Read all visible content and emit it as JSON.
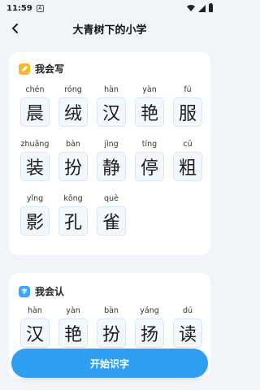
{
  "status": {
    "time": "11:59",
    "notification_badge": "A"
  },
  "nav": {
    "title": "大青树下的小学"
  },
  "write_section": {
    "title": "我会写",
    "rows": [
      [
        {
          "pinyin": "chén",
          "char": "晨"
        },
        {
          "pinyin": "róng",
          "char": "绒"
        },
        {
          "pinyin": "hàn",
          "char": "汉"
        },
        {
          "pinyin": "yàn",
          "char": "艳"
        },
        {
          "pinyin": "fú",
          "char": "服"
        }
      ],
      [
        {
          "pinyin": "zhuāng",
          "char": "装"
        },
        {
          "pinyin": "bàn",
          "char": "扮"
        },
        {
          "pinyin": "jìng",
          "char": "静"
        },
        {
          "pinyin": "tíng",
          "char": "停"
        },
        {
          "pinyin": "cū",
          "char": "粗"
        }
      ],
      [
        {
          "pinyin": "yǐng",
          "char": "影"
        },
        {
          "pinyin": "kǒng",
          "char": "孔"
        },
        {
          "pinyin": "què",
          "char": "雀"
        }
      ]
    ]
  },
  "read_section": {
    "title": "我会认",
    "rows": [
      [
        {
          "pinyin": "hàn",
          "char": "汉"
        },
        {
          "pinyin": "yàn",
          "char": "艳"
        },
        {
          "pinyin": "bàn",
          "char": "扮"
        },
        {
          "pinyin": "yáng",
          "char": "扬"
        },
        {
          "pinyin": "dú",
          "char": "读"
        }
      ]
    ]
  },
  "start_button": {
    "label": "开始识字"
  },
  "colors": {
    "accent": "#2f9ff2",
    "write_icon": "#f7b928",
    "read_icon": "#3ea5ff"
  }
}
